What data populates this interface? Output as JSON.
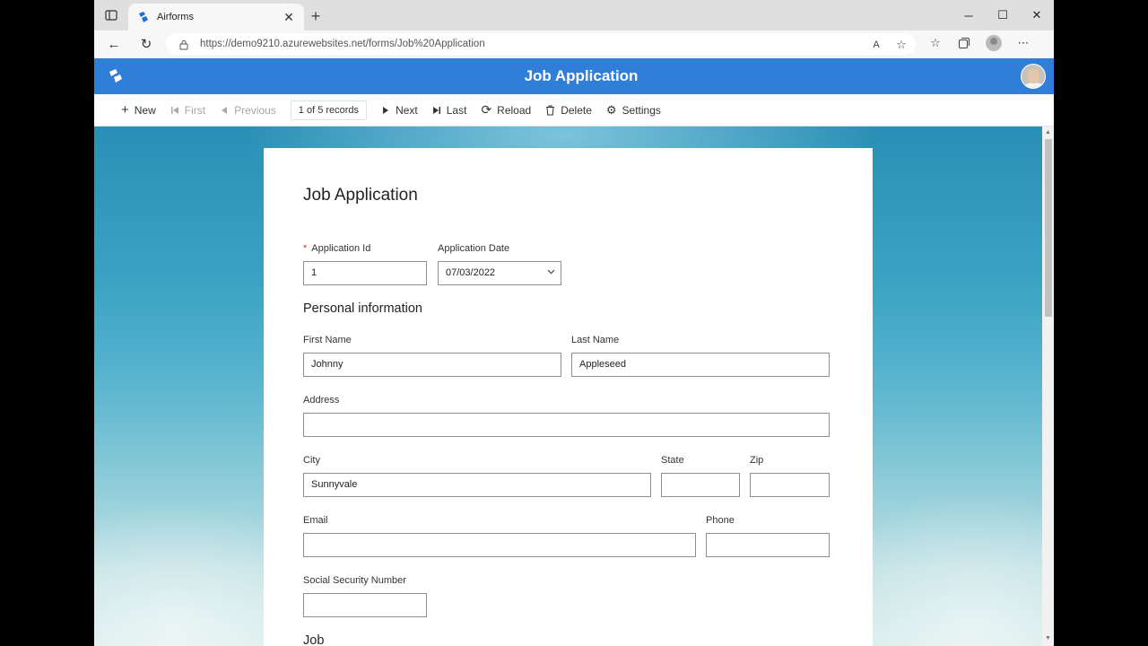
{
  "browser": {
    "tab_title": "Airforms",
    "url": "https://demo9210.azurewebsites.net/forms/Job%20Application"
  },
  "app": {
    "title": "Job Application"
  },
  "commands": {
    "new": "New",
    "first": "First",
    "previous": "Previous",
    "record_count": "1 of 5 records",
    "next": "Next",
    "last": "Last",
    "reload": "Reload",
    "delete": "Delete",
    "settings": "Settings"
  },
  "form": {
    "title": "Job Application",
    "application_id": {
      "label": "Application Id",
      "value": "1",
      "required": true
    },
    "application_date": {
      "label": "Application Date",
      "value": "07/03/2022"
    },
    "personal_section": "Personal information",
    "first_name": {
      "label": "First Name",
      "value": "Johnny"
    },
    "last_name": {
      "label": "Last Name",
      "value": "Appleseed"
    },
    "address": {
      "label": "Address",
      "value": ""
    },
    "city": {
      "label": "City",
      "value": "Sunnyvale"
    },
    "state": {
      "label": "State",
      "value": ""
    },
    "zip": {
      "label": "Zip",
      "value": ""
    },
    "email": {
      "label": "Email",
      "value": ""
    },
    "phone": {
      "label": "Phone",
      "value": ""
    },
    "ssn": {
      "label": "Social Security Number",
      "value": ""
    },
    "job_section": "Job"
  },
  "colors": {
    "header_blue": "#2f7ed8",
    "required_red": "#d0352b"
  },
  "icons": [
    "tab-actions-icon",
    "airforms-favicon",
    "close-icon",
    "plus-icon",
    "back-icon",
    "refresh-icon",
    "lock-icon",
    "read-aloud-icon",
    "add-favorite-icon",
    "favorites-icon",
    "collections-icon",
    "profile-icon",
    "more-icon",
    "airforms-logo-icon",
    "first-icon",
    "previous-icon",
    "next-icon",
    "last-icon",
    "reload-icon",
    "delete-icon",
    "settings-icon",
    "chevron-down-icon"
  ]
}
